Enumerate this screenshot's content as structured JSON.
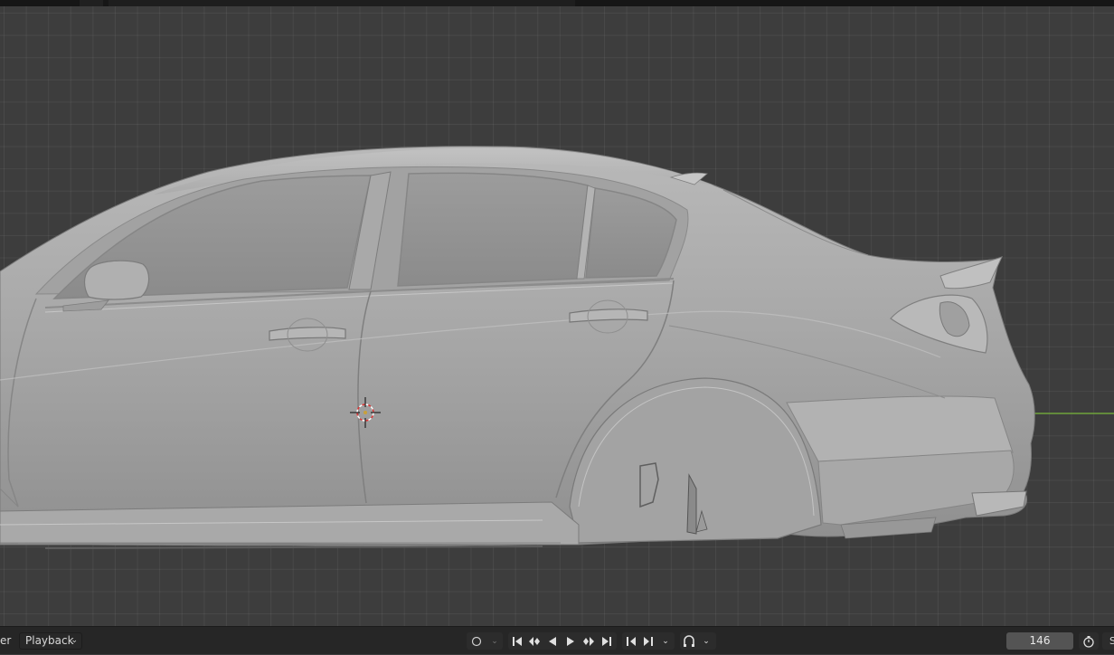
{
  "app": "Blender",
  "viewport": {
    "description_icon": "3d-cursor-icon",
    "axis_line_color": "#6fa33a",
    "grid_color": "#4a4a4a"
  },
  "timeline": {
    "editor_label_partial": "er",
    "playback_menu": "Playback",
    "current_frame": "146",
    "right_edge_partial": "S",
    "icons": {
      "record": "record-icon",
      "jump_start": "jump-to-start-icon",
      "prev_keyframe": "prev-keyframe-icon",
      "play_reverse": "play-reverse-icon",
      "play": "play-icon",
      "next_keyframe": "next-keyframe-icon",
      "jump_end": "jump-to-end-icon",
      "prev_key_interp": "prev-interp-icon",
      "next_key_interp": "next-interp-icon",
      "keying": "keying-icon",
      "auto_key": "auto-keying-icon",
      "stopwatch": "stopwatch-icon"
    }
  }
}
